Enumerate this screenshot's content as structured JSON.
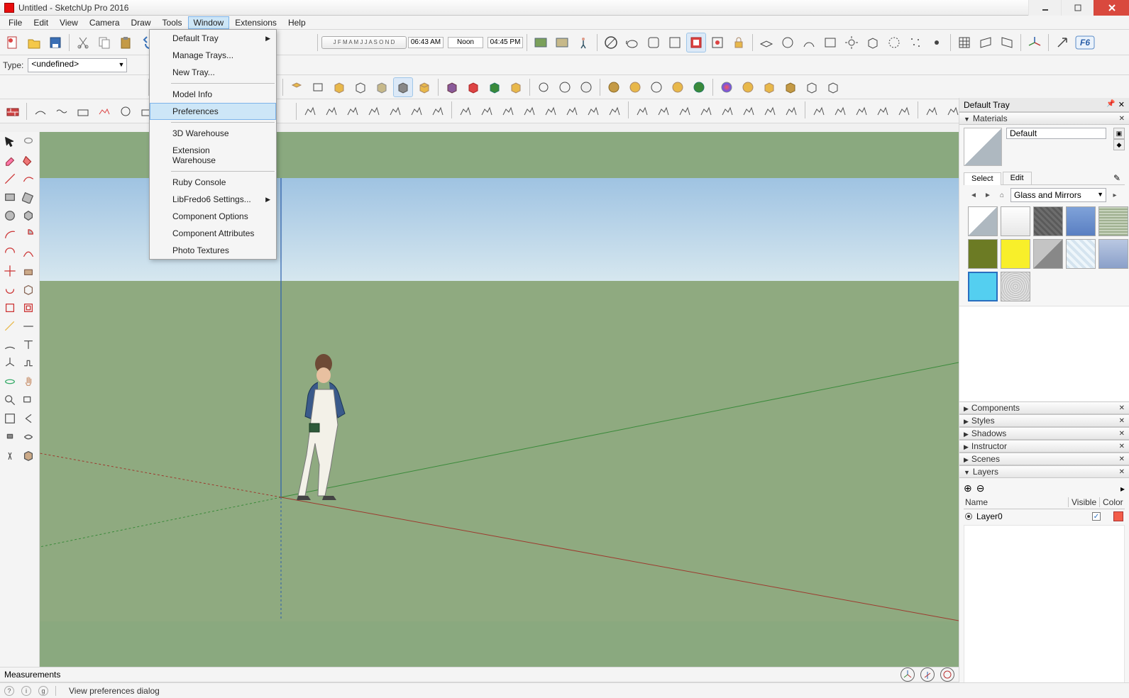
{
  "titlebar": {
    "title": "Untitled - SketchUp Pro 2016"
  },
  "menubar": [
    "File",
    "Edit",
    "View",
    "Camera",
    "Draw",
    "Tools",
    "Window",
    "Extensions",
    "Help"
  ],
  "active_menu_index": 6,
  "dropdown": {
    "items": [
      {
        "label": "Default Tray",
        "submenu": true
      },
      {
        "label": "Manage Trays..."
      },
      {
        "label": "New Tray..."
      },
      {
        "sep": true
      },
      {
        "label": "Model Info"
      },
      {
        "label": "Preferences",
        "highlight": true
      },
      {
        "sep": true
      },
      {
        "label": "3D Warehouse"
      },
      {
        "label": "Extension Warehouse"
      },
      {
        "sep": true
      },
      {
        "label": "Ruby Console"
      },
      {
        "label": "LibFredo6 Settings...",
        "submenu": true
      },
      {
        "label": "Component Options"
      },
      {
        "label": "Component Attributes"
      },
      {
        "label": "Photo Textures"
      }
    ]
  },
  "type_row": {
    "label": "Type:",
    "value": "<undefined>"
  },
  "time_widget": {
    "start": "06:43 AM",
    "mid": "Noon",
    "end": "04:45 PM"
  },
  "month_letters": "J F M A M J J A S O N D",
  "tray": {
    "title": "Default Tray",
    "materials": {
      "title": "Materials",
      "name": "Default",
      "tabs": [
        "Select",
        "Edit"
      ],
      "active_tab": 0,
      "category": "Glass and Mirrors",
      "swatches": [
        {
          "css": "background:linear-gradient(135deg,#fff 0 50%,#aeb8c0 50% 100%)"
        },
        {
          "css": "background:linear-gradient(#fefefe,#e7e7e7)"
        },
        {
          "css": "background:repeating-linear-gradient(45deg,#6d6d6d 0 3px,#5a5a5a 3px 6px)"
        },
        {
          "css": "background:linear-gradient(#7fa2d9,#5a7fc2)"
        },
        {
          "css": "background:repeating-linear-gradient(0deg,#9fb090 0 2px,#c7d3bd 2px 4px)"
        },
        {
          "css": "background:#6c7b24"
        },
        {
          "css": "background:#f8ef2a"
        },
        {
          "css": "background:linear-gradient(135deg,#c4c4c4 0 50%,#888 50% 100%)"
        },
        {
          "css": "background:repeating-linear-gradient(45deg,#d5e4ef 0 4px,#eef6fb 4px 8px)"
        },
        {
          "css": "background:linear-gradient(#b9c8e2,#8aa0c9)"
        },
        {
          "css": "background:#54cff0",
          "sel": true
        },
        {
          "css": "background:repeating-radial-gradient(circle,#bcbcbc 0 1px,#e0e0e0 1px 3px)"
        }
      ]
    },
    "panels": [
      "Components",
      "Styles",
      "Shadows",
      "Instructor",
      "Scenes",
      "Layers"
    ],
    "layers": {
      "cols": {
        "name": "Name",
        "visible": "Visible",
        "color": "Color"
      },
      "rows": [
        {
          "name": "Layer0",
          "visible": true,
          "color": "#f35c49"
        }
      ]
    }
  },
  "measure_label": "Measurements",
  "status_hint": "View preferences dialog",
  "status_icons": [
    "?",
    "i",
    "g"
  ]
}
